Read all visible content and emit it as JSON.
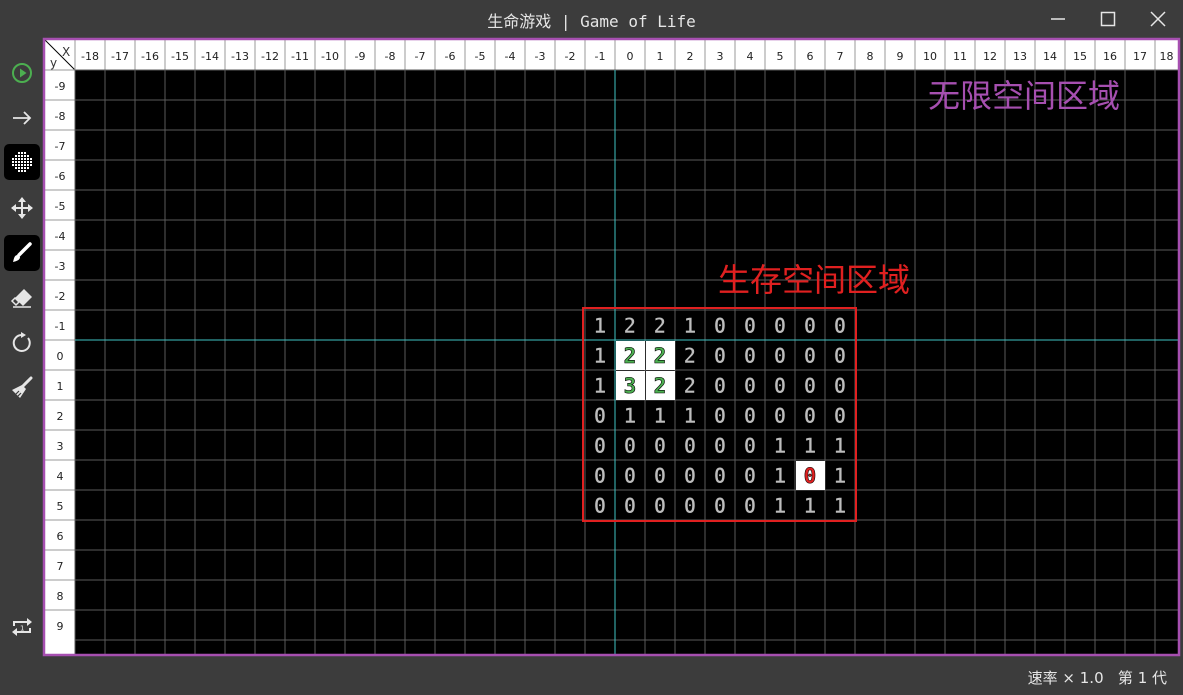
{
  "window": {
    "title": "生命游戏 | Game of Life",
    "controls": [
      "minimize-icon",
      "maximize-icon",
      "close-icon"
    ]
  },
  "toolbar": {
    "tools": [
      {
        "name": "run-icon",
        "active": false
      },
      {
        "name": "step-icon",
        "active": false
      },
      {
        "name": "grid-icon",
        "active": true
      },
      {
        "name": "move-icon",
        "active": false
      },
      {
        "name": "brush-icon",
        "active": true
      },
      {
        "name": "eraser-icon",
        "active": false
      },
      {
        "name": "reset-icon",
        "active": false
      },
      {
        "name": "clear-icon",
        "active": false
      }
    ],
    "bottom_tool": "rule-toggle-icon"
  },
  "grid": {
    "x_min": -18,
    "x_max": 18,
    "y_min": -9,
    "y_max": 9,
    "corner_x_label": "X",
    "corner_y_label": "y",
    "x_labels": [
      "-18",
      "-17",
      "-16",
      "-15",
      "-14",
      "-13",
      "-12",
      "-11",
      "-10",
      "-9",
      "-8",
      "-7",
      "-6",
      "-5",
      "-4",
      "-3",
      "-2",
      "-1",
      "0",
      "1",
      "2",
      "3",
      "4",
      "5",
      "6",
      "7",
      "8",
      "9",
      "10",
      "11",
      "12",
      "13",
      "14",
      "15",
      "16",
      "17",
      "18"
    ],
    "y_labels": [
      "-9",
      "-8",
      "-7",
      "-6",
      "-5",
      "-4",
      "-3",
      "-2",
      "-1",
      "0",
      "1",
      "2",
      "3",
      "4",
      "5",
      "6",
      "7",
      "8",
      "9"
    ]
  },
  "annotations": {
    "infinite_space": "无限空间区域",
    "living_space": "生存空间区域",
    "infinite_color": "#a64fb0",
    "living_color": "#e02020"
  },
  "living_area": {
    "x_from": -1,
    "y_from": -1,
    "columns": [
      "-1",
      "0",
      "1",
      "2",
      "3",
      "4",
      "5",
      "6",
      "7"
    ],
    "rows": [
      {
        "y": "-1",
        "counts": [
          "1",
          "2",
          "2",
          "1",
          "0",
          "0",
          "0",
          "0",
          "0"
        ]
      },
      {
        "y": "0",
        "counts": [
          "1",
          "2",
          "2",
          "2",
          "0",
          "0",
          "0",
          "0",
          "0"
        ]
      },
      {
        "y": "1",
        "counts": [
          "1",
          "3",
          "2",
          "2",
          "0",
          "0",
          "0",
          "0",
          "0"
        ]
      },
      {
        "y": "2",
        "counts": [
          "0",
          "1",
          "1",
          "1",
          "0",
          "0",
          "0",
          "0",
          "0"
        ]
      },
      {
        "y": "3",
        "counts": [
          "0",
          "0",
          "0",
          "0",
          "0",
          "0",
          "1",
          "1",
          "1"
        ]
      },
      {
        "y": "4",
        "counts": [
          "0",
          "0",
          "0",
          "0",
          "0",
          "0",
          "1",
          "0",
          "1"
        ]
      },
      {
        "y": "5",
        "counts": [
          "0",
          "0",
          "0",
          "0",
          "0",
          "0",
          "1",
          "1",
          "1"
        ]
      }
    ],
    "alive_cells": [
      {
        "x": 0,
        "y": 0,
        "count_color": "#4caf50"
      },
      {
        "x": 1,
        "y": 0,
        "count_color": "#4caf50"
      },
      {
        "x": 1,
        "y": 1,
        "count_color": "#4caf50"
      },
      {
        "x": 6,
        "y": 4,
        "count_color": "#e02020"
      }
    ],
    "highlight_cells": [
      {
        "x": 0,
        "y": 1,
        "count_color": "#4caf50"
      }
    ]
  },
  "status": {
    "text": "速率 × 1.0   第 1 代"
  },
  "colors": {
    "background": "#3c3c3c",
    "board": "#000000",
    "grid_line": "#5a5a5a",
    "axis_line": "#3fc4c4",
    "count_text": "#bdbdbd",
    "alive_fill": "#ffffff"
  }
}
